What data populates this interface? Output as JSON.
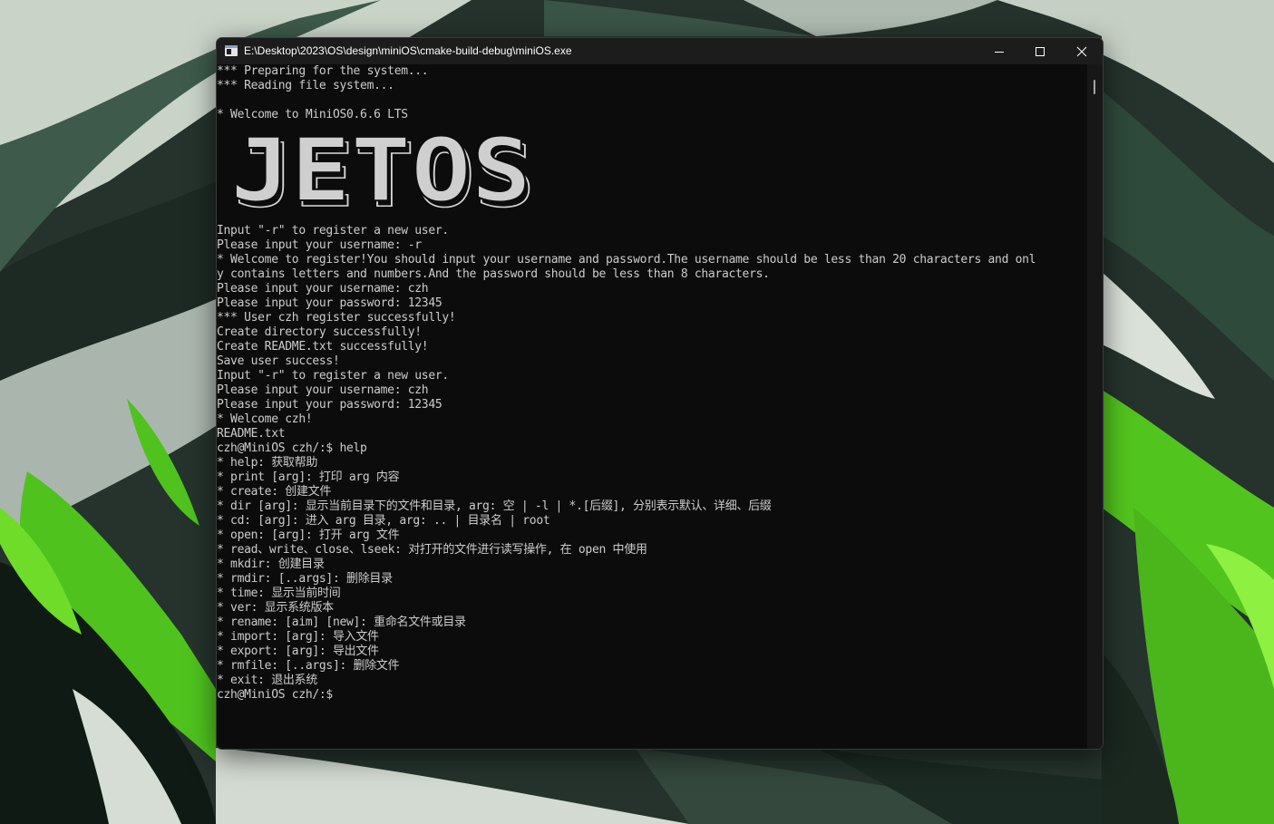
{
  "window": {
    "title": "E:\\Desktop\\2023\\OS\\design\\miniOS\\cmake-build-debug\\miniOS.exe"
  },
  "console": {
    "header_lines": [
      "*** Preparing for the system...",
      "*** Reading file system...",
      "",
      "* Welcome to MiniOS0.6.6 LTS"
    ],
    "logo_text": "JETOS",
    "session_lines": [
      "",
      "Input \"-r\" to register a new user.",
      "Please input your username: -r",
      "* Welcome to register!You should input your username and password.The username should be less than 20 characters and onl",
      "y contains letters and numbers.And the password should be less than 8 characters.",
      "Please input your username: czh",
      "Please input your password: 12345",
      "*** User czh register successfully!",
      "Create directory successfully!",
      "Create README.txt successfully!",
      "Save user success!",
      "Input \"-r\" to register a new user.",
      "Please input your username: czh",
      "Please input your password: 12345",
      "* Welcome czh!",
      "README.txt",
      "czh@MiniOS czh/:$ help",
      "* help: 获取帮助",
      "* print [arg]: 打印 arg 内容",
      "* create: 创建文件",
      "* dir [arg]: 显示当前目录下的文件和目录, arg: 空 | -l | *.[后缀], 分别表示默认、详细、后缀",
      "* cd: [arg]: 进入 arg 目录, arg: .. | 目录名 | root",
      "* open: [arg]: 打开 arg 文件",
      "* read、write、close、lseek: 对打开的文件进行读写操作, 在 open 中使用",
      "* mkdir: 创建目录",
      "* rmdir: [..args]: 删除目录",
      "* time: 显示当前时间",
      "* ver: 显示系统版本",
      "* rename: [aim] [new]: 重命名文件或目录",
      "* import: [arg]: 导入文件",
      "* export: [arg]: 导出文件",
      "* rmfile: [..args]: 删除文件",
      "* exit: 退出系统",
      "czh@MiniOS czh/:$"
    ]
  },
  "icons": {
    "app": "console-app-icon",
    "minimize": "minimize-icon",
    "maximize": "maximize-icon",
    "close": "close-icon"
  },
  "colors": {
    "console_bg": "#0c0c0c",
    "console_fg": "#cccccc",
    "titlebar_bg": "#1c1c1c",
    "logo_fill": "#cfcfcf",
    "wallpaper_green": "#4fc21e"
  }
}
